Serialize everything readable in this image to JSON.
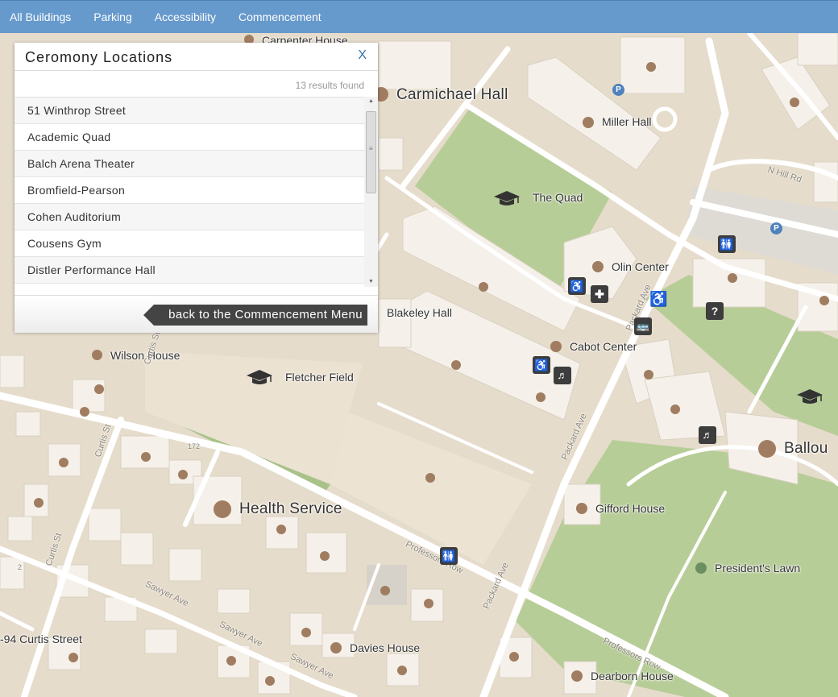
{
  "nav": {
    "items": [
      "All Buildings",
      "Parking",
      "Accessibility",
      "Commencement"
    ]
  },
  "panel": {
    "title": "Ceromony Locations",
    "close_label": "X",
    "results_count": "13 results found",
    "items": [
      "51 Winthrop Street",
      "Academic Quad",
      "Balch Arena Theater",
      "Bromfield-Pearson",
      "Cohen Auditorium",
      "Cousens Gym",
      "Distler Performance Hall"
    ],
    "back_label": "back to the Commencement Menu"
  },
  "map": {
    "labels": {
      "carpenter": "Carpenter House",
      "carmichael": "Carmichael Hall",
      "miller": "Miller Hall",
      "quad": "The Quad",
      "olin": "Olin Center",
      "blakeley": "Blakeley Hall",
      "cabot": "Cabot Center",
      "wilson": "Wilson House",
      "fletcher": "Fletcher Field",
      "ballou": "Ballou",
      "gifford": "Gifford House",
      "health": "Health Service",
      "presidents": "President's Lawn",
      "curtis94": "-94 Curtis Street",
      "davies": "Davies House",
      "dearborn": "Dearborn House"
    },
    "streets": {
      "n_hill": "N Hill Rd",
      "packard1": "Packard Ave",
      "packard2": "Packard Ave",
      "packard3": "Packard Ave",
      "curtis1": "Curtis St",
      "curtis2": "Curtis St",
      "curtis3": "Curtis St",
      "professors1": "Professors Row",
      "professors2": "Professors Row",
      "sawyer1": "Sawyer Ave",
      "sawyer2": "Sawyer Ave",
      "sawyer3": "Sawyer Ave",
      "num172": "172",
      "num2": "2"
    },
    "parking_label": "P",
    "colors": {
      "land": "#e6dccb",
      "building": "#f5f1ea",
      "green": "#b7cd98",
      "road": "#ffffff",
      "poi": "#a07d60",
      "nav": "#6699cc"
    }
  }
}
